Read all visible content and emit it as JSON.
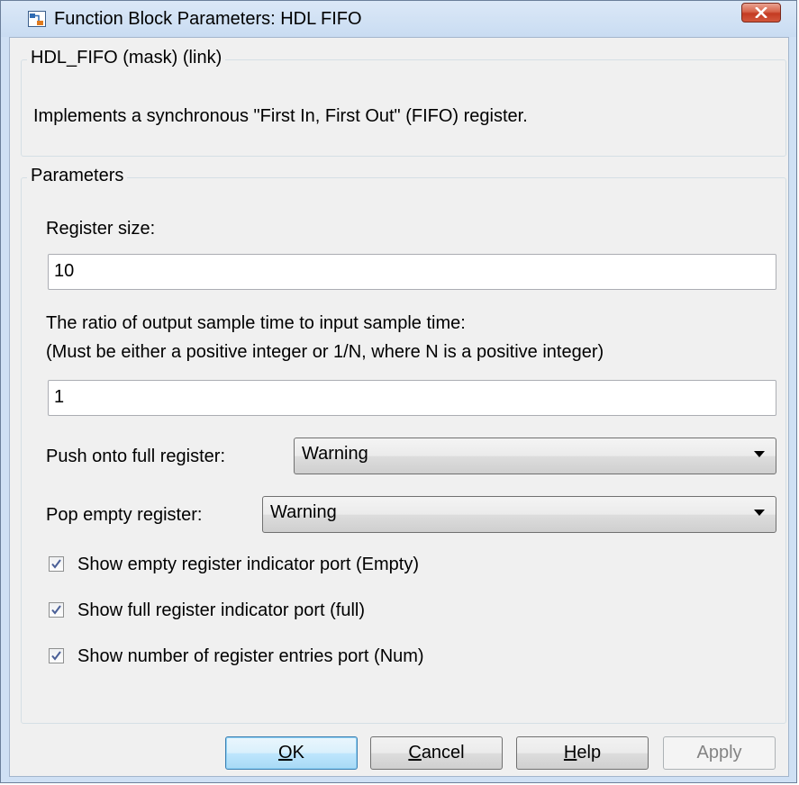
{
  "window": {
    "title": "Function Block Parameters: HDL FIFO"
  },
  "description": {
    "group_label": "HDL_FIFO (mask) (link)",
    "text": "Implements a synchronous \"First In, First Out\" (FIFO) register."
  },
  "parameters": {
    "group_label": "Parameters",
    "register_size": {
      "label": "Register size:",
      "value": "10"
    },
    "ratio": {
      "label_line1": "The ratio of output sample time to input sample time:",
      "label_line2": "(Must be either a positive integer or 1/N, where N is a positive integer)",
      "value": "1"
    },
    "push_full": {
      "label": "Push onto full register:",
      "selected": "Warning"
    },
    "pop_empty": {
      "label": "Pop empty register:",
      "selected": "Warning"
    },
    "checkboxes": [
      {
        "label": "Show empty register indicator port (Empty)",
        "checked": true
      },
      {
        "label": "Show full register indicator port (full)",
        "checked": true
      },
      {
        "label": "Show number of register entries port (Num)",
        "checked": true
      }
    ]
  },
  "buttons": {
    "ok": {
      "mnemonic": "O",
      "rest": "K"
    },
    "cancel": {
      "mnemonic": "C",
      "rest": "ancel"
    },
    "help": {
      "mnemonic": "H",
      "rest": "elp"
    },
    "apply": {
      "label": "Apply"
    }
  },
  "colors": {
    "title_bar": "#cfe0f4",
    "dialog_bg": "#f0f0f0",
    "close_button": "#c43a22",
    "default_button_border": "#3c7fb1",
    "checkbox_check": "#4a5f97"
  },
  "icons": {
    "app": "simulink-block-icon",
    "close": "close-icon",
    "dropdown": "chevron-down-icon",
    "check": "check-icon"
  }
}
